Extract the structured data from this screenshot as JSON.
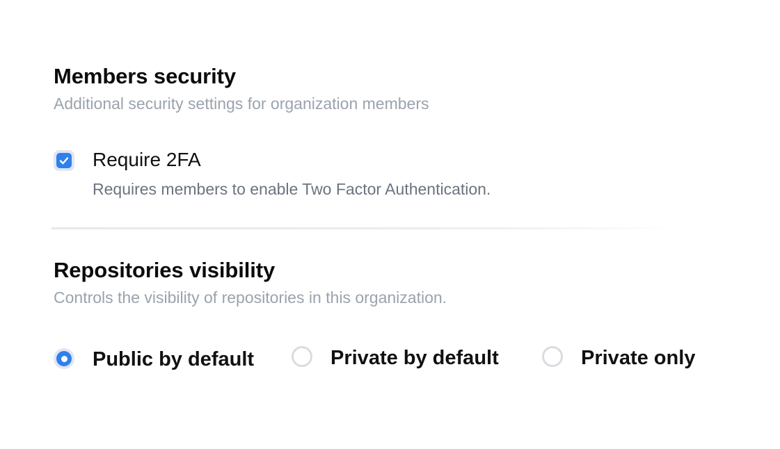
{
  "members_security": {
    "title": "Members security",
    "description": "Additional security settings for organization members",
    "require_2fa": {
      "label": "Require 2FA",
      "help": "Requires members to enable Two Factor Authentication.",
      "checked": true
    }
  },
  "repositories_visibility": {
    "title": "Repositories visibility",
    "description": "Controls the visibility of repositories in this organization.",
    "options": [
      {
        "label": "Public by default",
        "selected": true
      },
      {
        "label": "Private by default",
        "selected": false
      },
      {
        "label": "Private only",
        "selected": false
      }
    ]
  },
  "colors": {
    "accent": "#2f80ed",
    "muted_text": "#9aa3ad",
    "help_text": "#6b7380"
  }
}
